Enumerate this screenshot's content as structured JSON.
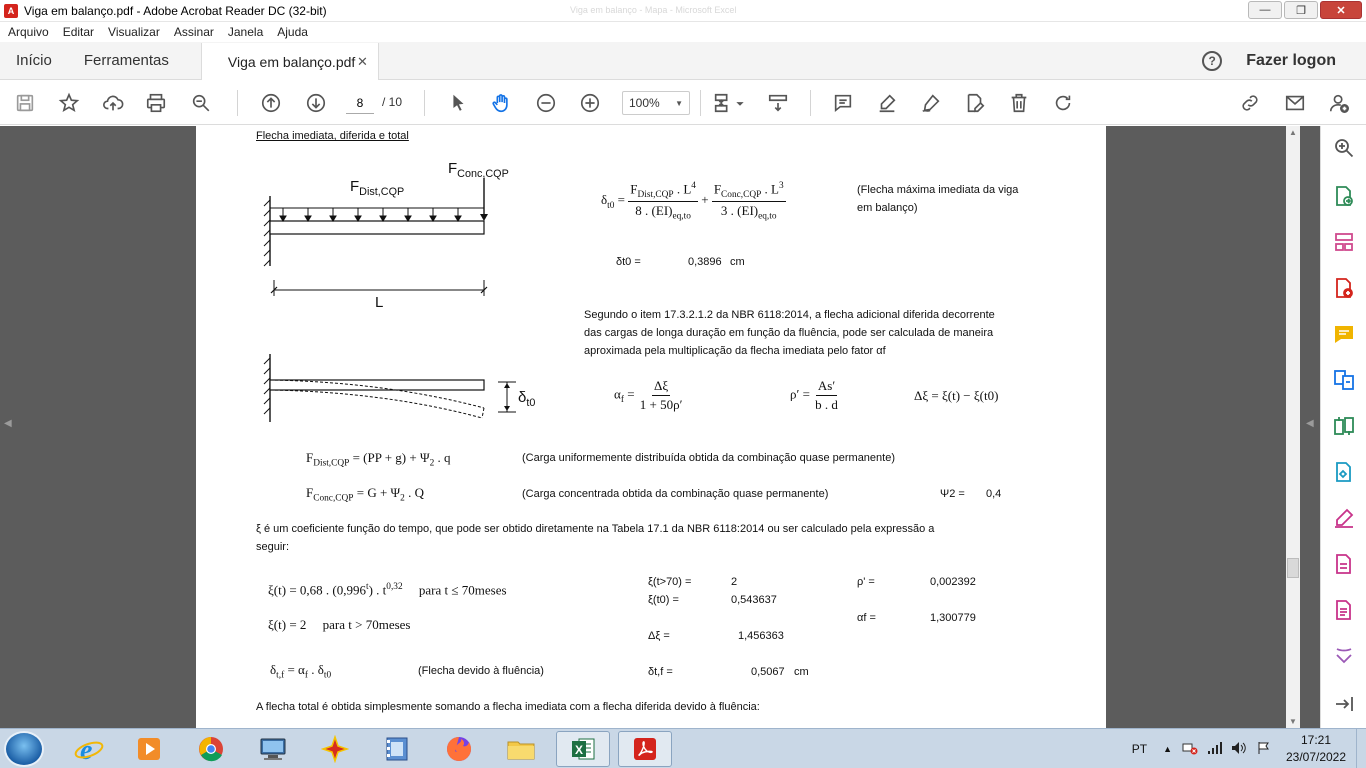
{
  "window": {
    "title": "Viga em balanço.pdf - Adobe Acrobat Reader DC (32-bit)",
    "ghost_title": "Viga em balanço - Mapa - Microsoft Excel"
  },
  "menu": [
    "Arquivo",
    "Editar",
    "Visualizar",
    "Assinar",
    "Janela",
    "Ajuda"
  ],
  "tabs": {
    "home": "Início",
    "tools": "Ferramentas",
    "document": "Viga em balanço.pdf",
    "login": "Fazer logon"
  },
  "toolbar": {
    "page_current": "8",
    "page_total": "/ 10",
    "zoom": "100%"
  },
  "pdf": {
    "section_title": "Flecha imediata, diferida e total",
    "diagram": {
      "f_dist": "F",
      "f_dist_sub": "Dist,CQP",
      "f_conc": "F",
      "f_conc_sub": "Conc,CQP",
      "length_label": "L",
      "delta": "δ",
      "delta_sub": "t0"
    },
    "eq_delta_note_1": "(Flecha máxima imediata da viga",
    "eq_delta_note_2": "em balanço)",
    "delta_t0_label": "δt0 =",
    "delta_t0_value": "0,3896",
    "delta_t0_unit": "cm",
    "para_1": "Segundo o item 17.3.2.1.2 da NBR 6118:2014, a flecha adicional diferida decorrente",
    "para_2": "das cargas de longa duração em função da fluência, pode ser calculada de maneira",
    "para_3": "aproximada pela multiplicação da flecha imediata pelo fator αf",
    "fdist_note": "(Carga uniformemente distribuída obtida da combinação quase permanente)",
    "fconc_note": "(Carga concentrada obtida da combinação quase permanente)",
    "psi_label": "Ψ2 =",
    "psi_value": "0,4",
    "xi_para_1": "ξ é um coeficiente função do tempo, que pode ser obtido diretamente na Tabela 17.1 da NBR 6118:2014 ou ser calculado pela expressão a",
    "xi_para_2": "seguir:",
    "xi_gt70_label": "ξ(t>70) =",
    "xi_gt70_value": "2",
    "xi_t0_label": "ξ(t0) =",
    "xi_t0_value": "0,543637",
    "dxi_label": "Δξ =",
    "dxi_value": "1,456363",
    "rho_label": "ρ' =",
    "rho_value": "0,002392",
    "alpha_label": "αf =",
    "alpha_value": "1,300779",
    "creep_note": "(Flecha devido à fluência)",
    "dtf_label": "δt,f =",
    "dtf_value": "0,5067",
    "dtf_unit": "cm",
    "final_para": "A flecha total é obtida simplesmente somando a flecha imediata com a flecha diferida devido à fluência:"
  },
  "taskbar": {
    "lang": "PT",
    "time": "17:21",
    "date": "23/07/2022"
  },
  "colors": {
    "acrobat_red": "#d4241c",
    "accent_blue": "#1473e6",
    "workspace": "#5c5c5c"
  }
}
